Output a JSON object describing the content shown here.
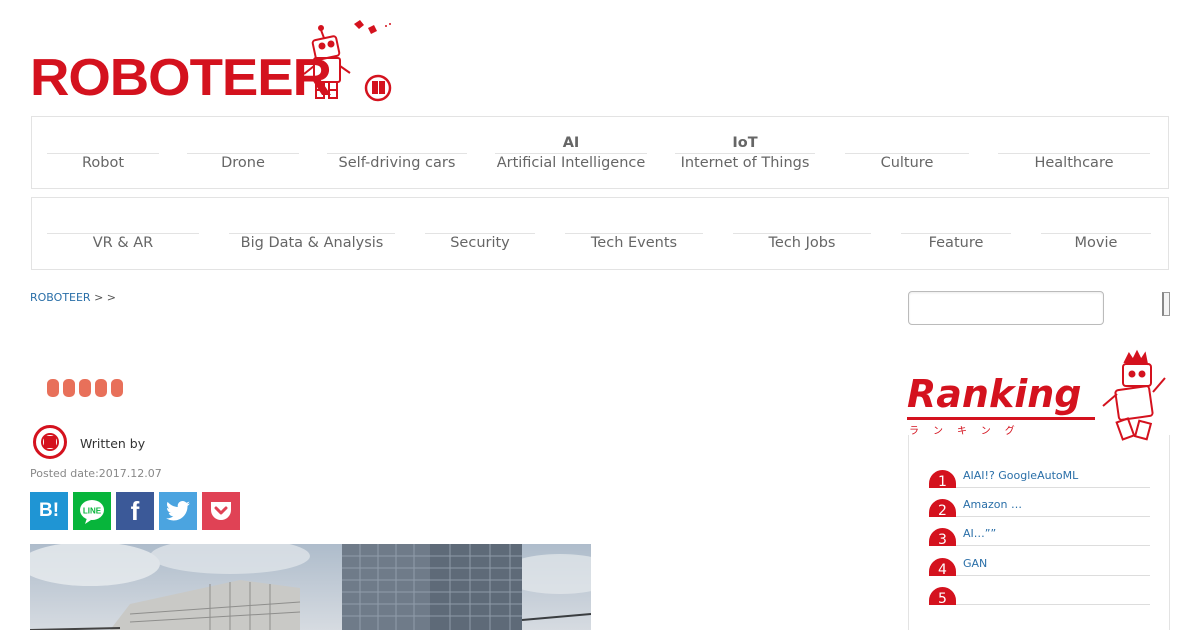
{
  "logo": {
    "text": "ROBOTEER"
  },
  "nav_row1": [
    {
      "top": "",
      "label": "Robot"
    },
    {
      "top": "",
      "label": "Drone"
    },
    {
      "top": "",
      "label": "Self-driving cars"
    },
    {
      "top": "AI",
      "label": "Artificial Intelligence"
    },
    {
      "top": "IoT",
      "label": "Internet of Things"
    },
    {
      "top": "",
      "label": "Culture"
    },
    {
      "top": "",
      "label": "Healthcare"
    }
  ],
  "nav_row2": [
    {
      "label": "VR & AR"
    },
    {
      "label": "Big Data & Analysis"
    },
    {
      "label": "Security"
    },
    {
      "label": "Tech Events"
    },
    {
      "label": "Tech Jobs"
    },
    {
      "label": "Feature"
    },
    {
      "label": "Movie"
    }
  ],
  "breadcrumb": {
    "home": "ROBOTEER",
    "sep1": " > ",
    "sep2": " > "
  },
  "search": {
    "placeholder": ""
  },
  "rating": {
    "count": 5
  },
  "article": {
    "written_by": "Written by",
    "posted_date": "Posted date:2017.12.07"
  },
  "share": {
    "hatena": "B!",
    "facebook": "f"
  },
  "ranking": {
    "title": "Ranking",
    "subtitle": "ランキング",
    "items": [
      {
        "num": "1",
        "text": "AIAI!? GoogleAutoML"
      },
      {
        "num": "2",
        "text": "Amazon …"
      },
      {
        "num": "3",
        "text": "AI…”” "
      },
      {
        "num": "4",
        "text": "GAN"
      },
      {
        "num": "5",
        "text": ""
      }
    ]
  },
  "colors": {
    "brand_red": "#d4121e",
    "link_blue": "#2a6fa8",
    "rating_orange": "#e8705a"
  }
}
